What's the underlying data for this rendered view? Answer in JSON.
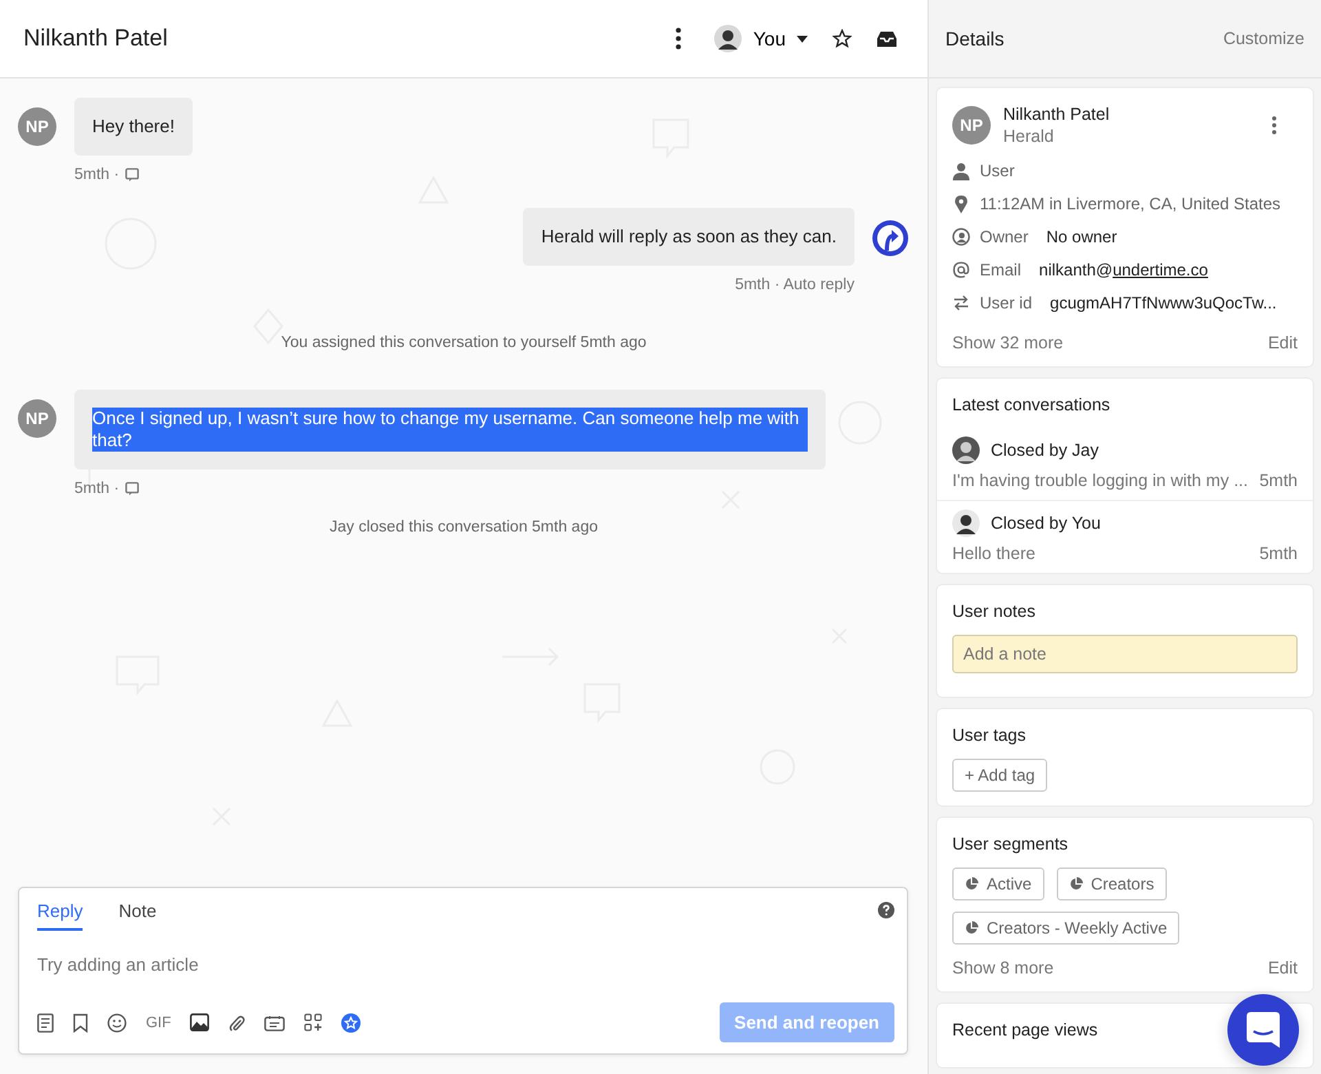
{
  "header": {
    "title": "Nilkanth Patel",
    "assignee": "You"
  },
  "messages": [
    {
      "kind": "incoming",
      "initials": "NP",
      "text": "Hey there!",
      "time": "5mth ·",
      "highlighted": false
    },
    {
      "kind": "outgoing",
      "text": "Herald will reply as soon as they can.",
      "time": "5mth · Auto reply"
    },
    {
      "kind": "event",
      "text": "You assigned this conversation to yourself 5mth ago"
    },
    {
      "kind": "incoming",
      "initials": "NP",
      "text": "Once I signed up, I wasn’t sure how to change my username. Can someone help me with that?",
      "time": "5mth ·",
      "highlighted": true
    },
    {
      "kind": "event",
      "text": "Jay closed this conversation 5mth ago"
    }
  ],
  "composer": {
    "tabs": [
      {
        "label": "Reply",
        "selected": true
      },
      {
        "label": "Note",
        "selected": false
      }
    ],
    "placeholder": "Try adding an article",
    "gif_label": "GIF",
    "send_button": "Send and reopen"
  },
  "details": {
    "title": "Details",
    "customize": "Customize",
    "user": {
      "initials": "NP",
      "name": "Nilkanth Patel",
      "company": "Herald",
      "attributes": [
        {
          "kind": "type",
          "label": "User"
        },
        {
          "kind": "location",
          "value": "11:12AM in Livermore, CA, United States"
        },
        {
          "kind": "owner",
          "label": "Owner",
          "value": "No owner"
        },
        {
          "kind": "email",
          "label": "Email",
          "value": "nilkanth@",
          "link": "undertime.co"
        },
        {
          "kind": "userid",
          "label": "User id",
          "value": "gcugmAH7TfNwww3uQocTw..."
        }
      ],
      "show_more": "Show 32 more",
      "edit": "Edit"
    },
    "latest_conversations": {
      "title": "Latest conversations",
      "items": [
        {
          "status": "Closed by Jay",
          "preview": "I'm having trouble logging in with my ...",
          "time": "5mth"
        },
        {
          "status": "Closed by You",
          "preview": "Hello there",
          "time": "5mth"
        }
      ]
    },
    "notes": {
      "title": "User notes",
      "placeholder": "Add a note"
    },
    "tags": {
      "title": "User tags",
      "add": "+ Add tag"
    },
    "segments": {
      "title": "User segments",
      "items": [
        "Active",
        "Creators",
        "Creators - Weekly Active"
      ],
      "show_more": "Show 8 more",
      "edit": "Edit"
    },
    "page_views": {
      "title": "Recent page views"
    }
  }
}
